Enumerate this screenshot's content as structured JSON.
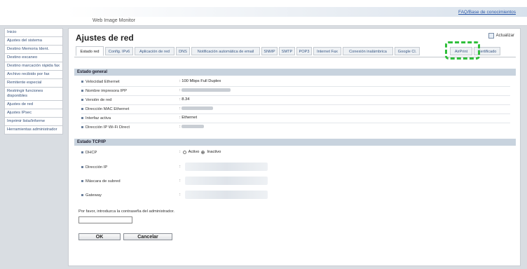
{
  "header": {
    "brand": "Web Image Monitor",
    "faq_link": "FAQ/Base de conocimientos"
  },
  "sidebar": {
    "items": [
      {
        "label": "Inicio"
      },
      {
        "label": "Ajustes del sistema"
      },
      {
        "label": "Destino Memoria Ident."
      },
      {
        "label": "Destino escaneo"
      },
      {
        "label": "Destino marcación rápida fax"
      },
      {
        "label": "Archivo recibido por fax"
      },
      {
        "label": "Remitente especial"
      },
      {
        "label": "Restringir funciones disponibles"
      },
      {
        "label": "Ajustes de red"
      },
      {
        "label": "Ajustes IPsec"
      },
      {
        "label": "Imprimir lista/Informe"
      },
      {
        "label": "Herramientas administrador"
      }
    ]
  },
  "page": {
    "title": "Ajustes de red",
    "refresh_label": "Actualizar"
  },
  "tabs": [
    {
      "label": "Estado red",
      "active": true
    },
    {
      "label": "Config. IPv6",
      "active": false
    },
    {
      "label": "Aplicación de red",
      "active": false
    },
    {
      "label": "DNS",
      "active": false
    },
    {
      "label": "Notificación automática de email",
      "active": false
    },
    {
      "label": "SNMP",
      "active": false
    },
    {
      "label": "SMTP",
      "active": false
    },
    {
      "label": "POP3",
      "active": false
    },
    {
      "label": "Internet Fax",
      "active": false
    },
    {
      "label": "Conexión inalámbrica",
      "active": false
    },
    {
      "label": "Google Cl.",
      "active": false
    },
    {
      "label": "AirPrint",
      "active": false
    },
    {
      "label": "Certificado",
      "active": false
    }
  ],
  "general": {
    "heading": "Estado general",
    "rows": [
      {
        "label": "Velocidad Ethernet",
        "value": ": 100 Mbps Full Duplex"
      },
      {
        "label": "Nombre impresora IPP",
        "value": ":"
      },
      {
        "label": "Versión de red",
        "value": ": 8.34"
      },
      {
        "label": "Dirección MAC Ethernet",
        "value": ":"
      },
      {
        "label": "Interfaz activa",
        "value": ": Ethernet"
      },
      {
        "label": "Dirección IP Wi-Fi Direct",
        "value": ":"
      }
    ]
  },
  "tcpip": {
    "heading": "Estado TCP/IP",
    "dhcp_label": "DHCP",
    "dhcp_active": "Activo",
    "dhcp_inactive": "Inactivo",
    "rows": [
      {
        "label": "Dirección IP",
        "value": ":"
      },
      {
        "label": "Máscara de subred",
        "value": ":"
      },
      {
        "label": "Gateway",
        "value": ":"
      }
    ]
  },
  "password": {
    "prompt": "Por favor, introduzca la contraseña del administrador."
  },
  "buttons": {
    "ok": "OK",
    "cancel": "Cancelar"
  },
  "colors": {
    "highlight": "#2fbf3a",
    "section_header": "#c8d3de",
    "link": "#2a57a6"
  }
}
